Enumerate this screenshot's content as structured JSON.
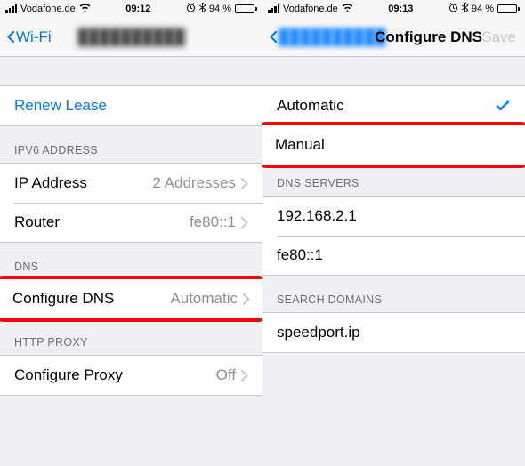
{
  "left": {
    "status": {
      "carrier": "Vodafone.de",
      "time": "09:12",
      "battery": "94 %",
      "alarm": "⏰",
      "bt": "✳︎"
    },
    "nav": {
      "back": "Wi-Fi",
      "title": "██████████"
    },
    "renew_lease": "Renew Lease",
    "ipv6_header": "IPV6 ADDRESS",
    "ip_address_label": "IP Address",
    "ip_address_value": "2 Addresses",
    "router_label": "Router",
    "router_value": "fe80::1",
    "dns_header": "DNS",
    "configure_dns_label": "Configure DNS",
    "configure_dns_value": "Automatic",
    "http_proxy_header": "HTTP PROXY",
    "configure_proxy_label": "Configure Proxy",
    "configure_proxy_value": "Off"
  },
  "right": {
    "status": {
      "carrier": "Vodafone.de",
      "time": "09:13",
      "battery": "94 %"
    },
    "nav": {
      "back": "██████████",
      "title": "Configure DNS",
      "save": "Save"
    },
    "automatic": "Automatic",
    "manual": "Manual",
    "dns_servers_header": "DNS SERVERS",
    "server1": "192.168.2.1",
    "server2": "fe80::1",
    "search_domains_header": "SEARCH DOMAINS",
    "domain1": "speedport.ip"
  }
}
